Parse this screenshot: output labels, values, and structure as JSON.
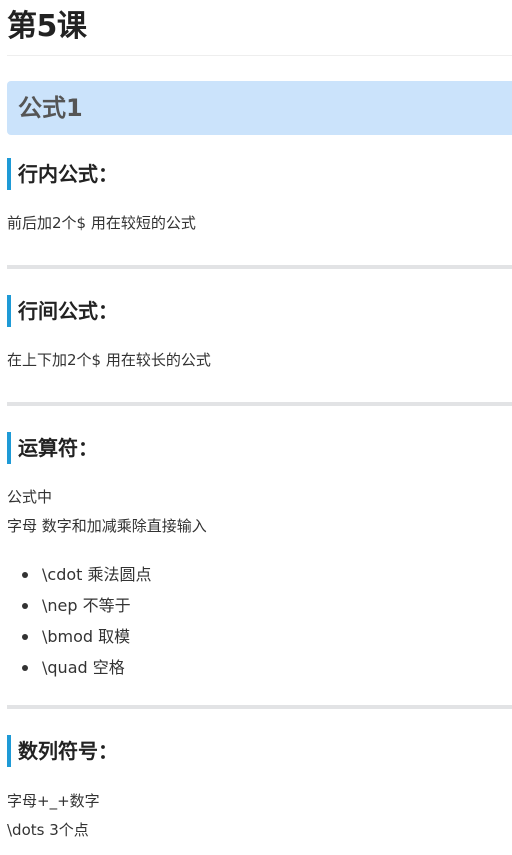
{
  "title": "第5课",
  "section": {
    "heading": "公式1",
    "blocks": [
      {
        "heading": "行内公式：",
        "lines": [
          "前后加2个$ 用在较短的公式"
        ]
      },
      {
        "heading": "行间公式：",
        "lines": [
          "在上下加2个$ 用在较长的公式"
        ]
      },
      {
        "heading": "运算符：",
        "lines": [
          "公式中",
          "字母 数字和加减乘除直接输入"
        ],
        "list": [
          "\\cdot 乘法圆点",
          "\\nep 不等于",
          "\\bmod 取模",
          "\\quad 空格"
        ]
      },
      {
        "heading": "数列符号：",
        "lines": [
          "字母+_+数字",
          "\\dots 3个点"
        ]
      }
    ]
  }
}
